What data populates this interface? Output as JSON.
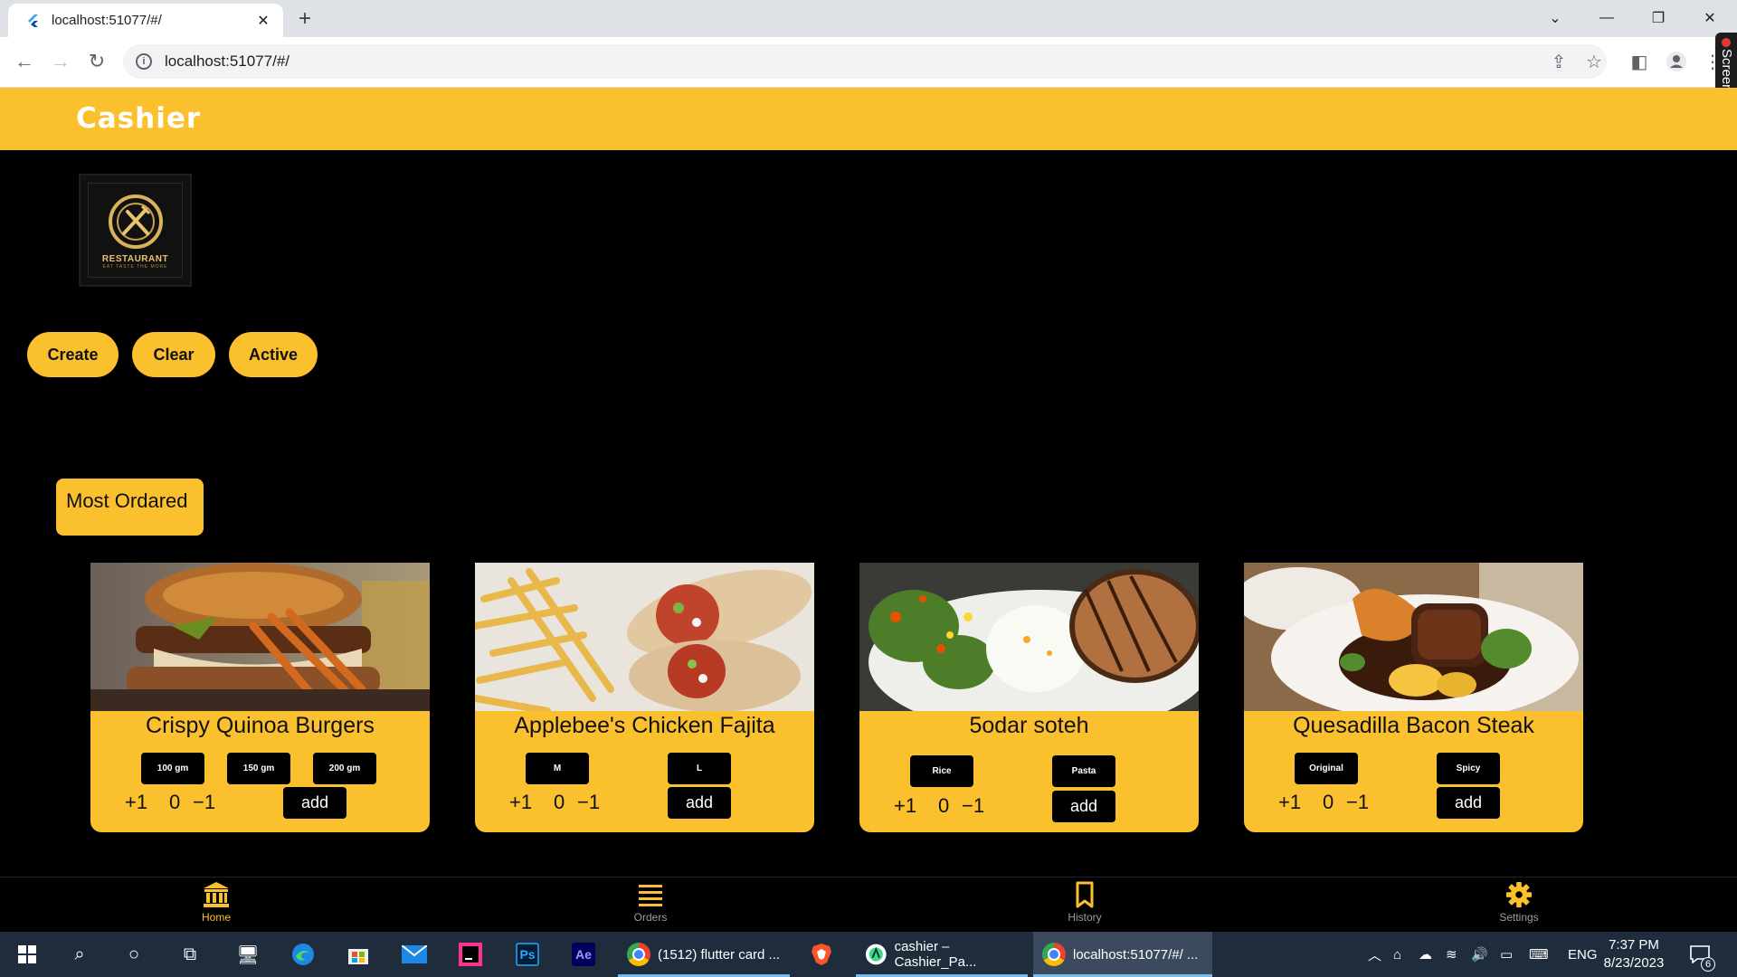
{
  "browser": {
    "tab_title": "localhost:51077/#/",
    "url": "localhost:51077/#/",
    "screenrec_label": "Screenrec"
  },
  "app": {
    "title": "Cashier",
    "logo": {
      "brand": "RESTAURANT",
      "tagline": "EAT  TASTE  THE  MORE"
    },
    "actions": [
      "Create",
      "Clear",
      "Active"
    ],
    "section_title": "Most Ordared",
    "colors": {
      "accent": "#fbc02d",
      "background": "#000000"
    },
    "products": [
      {
        "name": "Crispy Quinoa Burgers",
        "options": [
          "100 gm",
          "150 gm",
          "200 gm"
        ],
        "plus": "+1",
        "count": "0",
        "minus": "−1",
        "add_label": "add",
        "image": "burger"
      },
      {
        "name": "Applebee's Chicken Fajita",
        "options": [
          "M",
          "L"
        ],
        "plus": "+1",
        "count": "0",
        "minus": "−1",
        "add_label": "add",
        "image": "fajita"
      },
      {
        "name": "5odar soteh",
        "options": [
          "Rice",
          "Pasta"
        ],
        "plus": "+1",
        "count": "0",
        "minus": "−1",
        "add_label": "add",
        "image": "rice-chicken-salad"
      },
      {
        "name": "Quesadilla Bacon Steak",
        "options": [
          "Original",
          "Spicy"
        ],
        "plus": "+1",
        "count": "0",
        "minus": "−1",
        "add_label": "add",
        "image": "steak-plate"
      }
    ],
    "bottom_nav": [
      {
        "label": "Home",
        "icon": "bank-icon",
        "active": true
      },
      {
        "label": "Orders",
        "icon": "list-icon",
        "active": false
      },
      {
        "label": "History",
        "icon": "bookmark-icon",
        "active": false
      },
      {
        "label": "Settings",
        "icon": "gear-icon",
        "active": false
      }
    ]
  },
  "taskbar": {
    "apps": [
      {
        "label": "(1512) flutter card ...",
        "icon": "chrome-icon"
      },
      {
        "label": "cashier – Cashier_Pa...",
        "icon": "android-studio-icon"
      },
      {
        "label": "localhost:51077/#/ ...",
        "icon": "chrome-icon"
      }
    ],
    "language": "ENG",
    "time": "7:37 PM",
    "date": "8/23/2023",
    "notifications": "6"
  }
}
